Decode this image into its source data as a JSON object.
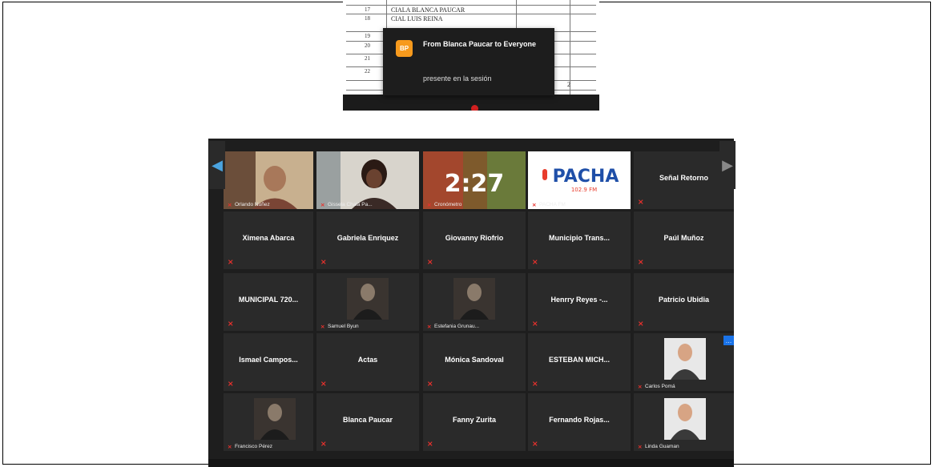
{
  "spreadsheet": {
    "rows": [
      {
        "num": "",
        "name": ""
      },
      {
        "num": "17",
        "name": "CIALA BLANCA PAUCAR"
      },
      {
        "num": "18",
        "name": "CIAL LUIS REINA"
      },
      {
        "num": "19",
        "name": ""
      },
      {
        "num": "20",
        "name": ""
      },
      {
        "num": "21",
        "name": ""
      },
      {
        "num": "22",
        "name": ""
      }
    ],
    "total": "2"
  },
  "chat_toast": {
    "initials": "BP",
    "title": "From Blanca Paucar to Everyone",
    "message": "presente en la sesión"
  },
  "gallery": {
    "timer_text": "2:27",
    "logo_text": "PACHA",
    "logo_freq": "102.9 FM",
    "tiles": [
      {
        "kind": "video",
        "label": "Orlando Nuñez"
      },
      {
        "kind": "video",
        "label": "Gissela Chala Pa..."
      },
      {
        "kind": "timer",
        "label": "Cronómetro"
      },
      {
        "kind": "logo",
        "label": "PACHA FM"
      },
      {
        "kind": "name",
        "name": "Señal Retorno"
      },
      {
        "kind": "name",
        "name": "Ximena Abarca"
      },
      {
        "kind": "name",
        "name": "Gabriela Enriquez"
      },
      {
        "kind": "name",
        "name": "Giovanny Riofrio"
      },
      {
        "kind": "name",
        "name": "Municipio Trans..."
      },
      {
        "kind": "name",
        "name": "Paúl Muñoz"
      },
      {
        "kind": "name",
        "name": "MUNICIPAL 720..."
      },
      {
        "kind": "photo",
        "label": "Samuel Byun"
      },
      {
        "kind": "photo",
        "label": "Estefania Grunau..."
      },
      {
        "kind": "name",
        "name": "Henrry Reyes -..."
      },
      {
        "kind": "name",
        "name": "Patricio Ubidia"
      },
      {
        "kind": "name",
        "name": "Ismael Campos..."
      },
      {
        "kind": "name",
        "name": "Actas"
      },
      {
        "kind": "name",
        "name": "Mónica Sandoval"
      },
      {
        "kind": "name",
        "name": "ESTEBAN MICH..."
      },
      {
        "kind": "photo",
        "label": "Carlos Pomá"
      },
      {
        "kind": "photo",
        "label": "Francisco Pérez"
      },
      {
        "kind": "name",
        "name": "Blanca Paucar"
      },
      {
        "kind": "name",
        "name": "Fanny Zurita"
      },
      {
        "kind": "name",
        "name": "Fernando Rojas..."
      },
      {
        "kind": "photo",
        "label": "Linda Guaman"
      }
    ]
  },
  "colors": {
    "accent": "#1a73e8",
    "mute_red": "#e8312c",
    "badge_orange": "#f79a1d"
  },
  "icons": {
    "mute": "muted-mic-icon",
    "prev": "chevron-left-icon",
    "next": "chevron-right-icon"
  }
}
